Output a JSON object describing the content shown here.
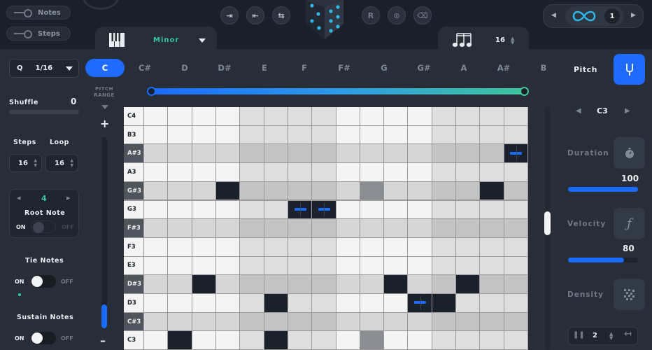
{
  "topbar": {
    "notes_label": "Notes",
    "steps_label": "Steps",
    "buttons": [
      {
        "name": "shift-right-button",
        "glyph": "⇥"
      },
      {
        "name": "shift-left-button",
        "glyph": "⇤"
      },
      {
        "name": "swap-button",
        "glyph": "⇆"
      },
      {
        "name": "reverse-button",
        "glyph": "R"
      },
      {
        "name": "lock-button",
        "glyph": "⊙"
      },
      {
        "name": "erase-button",
        "glyph": "⌫"
      }
    ],
    "scale": "Minor",
    "notes_value": "16",
    "loop_count": "1"
  },
  "sidebar": {
    "quantize_label": "Q",
    "quantize_value": "1/16",
    "shuffle_label": "Shuffle",
    "shuffle_value": "0",
    "steps_label": "Steps",
    "loop_label": "Loop",
    "steps_value": "16",
    "loop_value": "16",
    "root_value": "4",
    "root_label": "Root Note",
    "root_on": "ON",
    "root_off": "OFF",
    "tie_label": "Tie Notes",
    "tie_on": "ON",
    "tie_off": "OFF",
    "sustain_label": "Sustain Notes",
    "sustain_on": "ON",
    "sustain_off": "OFF"
  },
  "keys": [
    "C",
    "C#",
    "D",
    "D#",
    "E",
    "F",
    "F#",
    "G",
    "G#",
    "A",
    "A#",
    "B"
  ],
  "active_key": "C",
  "pitch_label": "Pitch",
  "pitch_range_label": "PITCH RANGE",
  "plus": "+",
  "minus": "–",
  "grid": {
    "rows": [
      {
        "label": "C4",
        "black": false
      },
      {
        "label": "B3",
        "black": false
      },
      {
        "label": "A#3",
        "black": true
      },
      {
        "label": "A3",
        "black": false
      },
      {
        "label": "G#3",
        "black": true
      },
      {
        "label": "G3",
        "black": false
      },
      {
        "label": "F#3",
        "black": true
      },
      {
        "label": "F3",
        "black": false
      },
      {
        "label": "E3",
        "black": false
      },
      {
        "label": "D#3",
        "black": true
      },
      {
        "label": "D3",
        "black": false
      },
      {
        "label": "C#3",
        "black": true
      },
      {
        "label": "C3",
        "black": false
      }
    ],
    "steps": 16,
    "active_notes": [
      {
        "row": "A#3",
        "step": 15
      },
      {
        "row": "G#3",
        "step": 3
      },
      {
        "row": "G#3",
        "step": 14
      },
      {
        "row": "G3",
        "step": 6
      },
      {
        "row": "G3",
        "step": 7
      },
      {
        "row": "D#3",
        "step": 2
      },
      {
        "row": "D#3",
        "step": 10
      },
      {
        "row": "D#3",
        "step": 13
      },
      {
        "row": "D3",
        "step": 5
      },
      {
        "row": "D3",
        "step": 11
      },
      {
        "row": "D3",
        "step": 12
      },
      {
        "row": "C3",
        "step": 1
      },
      {
        "row": "C3",
        "step": 5
      }
    ]
  },
  "right": {
    "octave": "C3",
    "duration_label": "Duration",
    "duration_value": "100",
    "velocity_label": "Velocity",
    "velocity_value": "80",
    "density_label": "Density",
    "footer_value": "2"
  },
  "colors": {
    "accent_blue": "#1f6bff",
    "accent_green": "#36c6a8",
    "grid_white_key": "#f3f3f3",
    "grid_black_key": "#d6d6d6",
    "grid_active": "#1b212a"
  }
}
